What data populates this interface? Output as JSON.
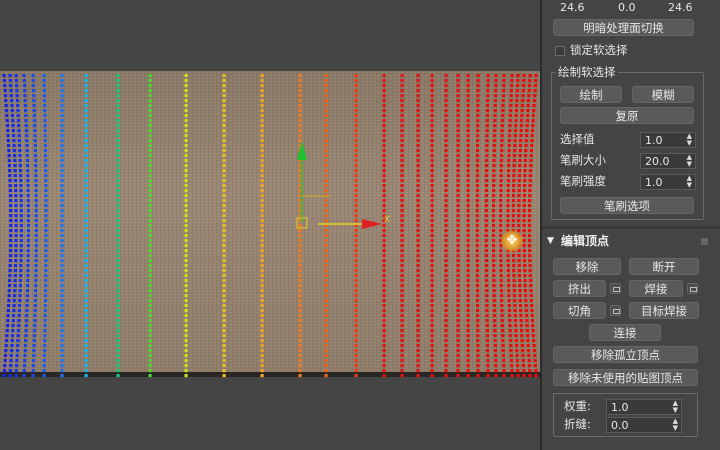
{
  "top_values": [
    "24.6",
    "0.0",
    "24.6"
  ],
  "shade_toggle_button": "明暗处理面切换",
  "lock_soft_selection": "锁定软选择",
  "paint_soft_selection_group": "绘制软选择",
  "paint_button": "绘制",
  "blur_button": "模糊",
  "revert_button": "复原",
  "selection_value": {
    "label": "选择值",
    "value": "1.0"
  },
  "brush_size": {
    "label": "笔刷大小",
    "value": "20.0"
  },
  "brush_strength": {
    "label": "笔刷强度",
    "value": "1.0"
  },
  "brush_options_button": "笔刷选项",
  "edit_vertices_header": "编辑顶点",
  "remove_button": "移除",
  "break_button": "断开",
  "extrude_button": "挤出",
  "weld_button": "焊接",
  "chamfer_button": "切角",
  "target_weld_button": "目标焊接",
  "connect_button": "连接",
  "remove_isolated_button": "移除孤立顶点",
  "remove_unused_map_button": "移除未使用的贴图顶点",
  "weight": {
    "label": "权重:",
    "value": "1.0"
  },
  "crease": {
    "label": "折缝:",
    "value": "0.0"
  },
  "gizmo_x_label": "X",
  "colors": {
    "viewport_bg": "#454545",
    "panel_bg": "#444444",
    "fabric": "#958270",
    "gizmo_x": "#e8d020",
    "gizmo_y": "#20c030",
    "arrow_red": "#e02020"
  },
  "icons": [
    "move-cursor-icon",
    "rollout-collapse-icon",
    "spinner-icon"
  ]
}
